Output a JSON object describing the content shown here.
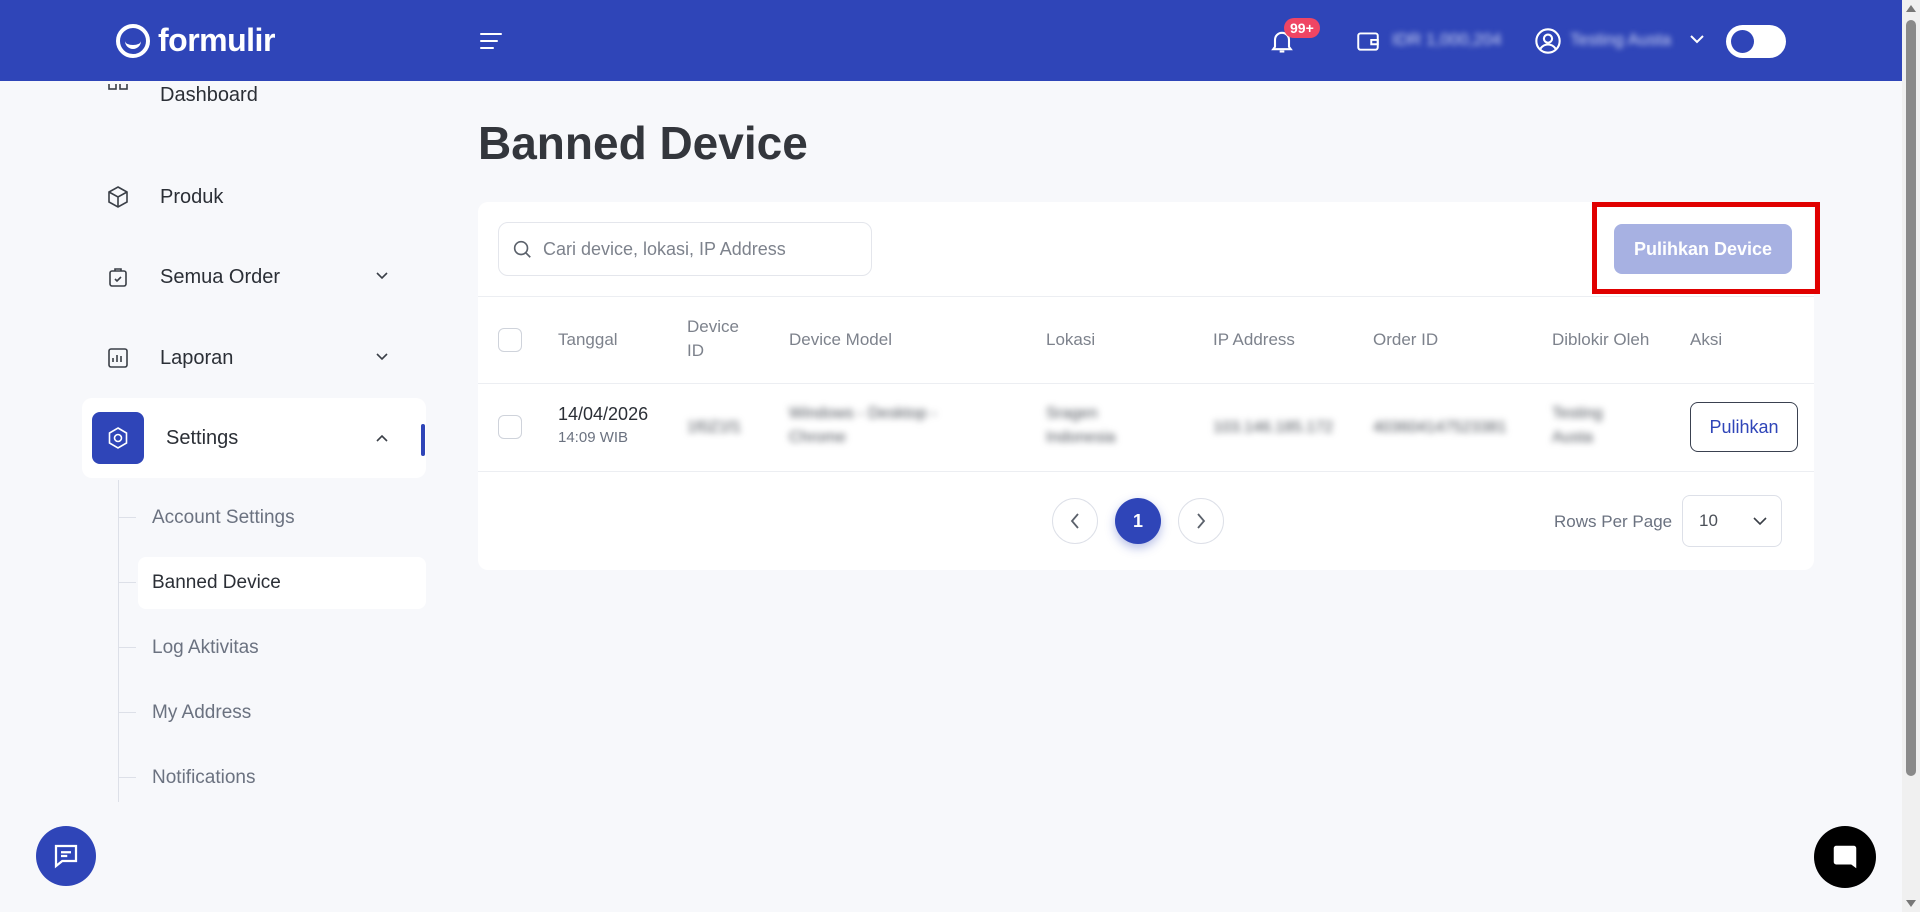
{
  "brand": {
    "name": "formulir",
    "primary": "#2f45b8"
  },
  "header": {
    "notification_badge": "99+",
    "balance": "IDR 1,000,204",
    "user_name": "Testing Austa"
  },
  "sidebar": {
    "items": [
      {
        "label": "Dashboard",
        "icon": "dashboard-icon"
      },
      {
        "label": "Produk",
        "icon": "box-icon"
      },
      {
        "label": "Semua Order",
        "icon": "order-bag-icon"
      },
      {
        "label": "Laporan",
        "icon": "report-icon"
      },
      {
        "label": "Settings",
        "icon": "gear-icon"
      }
    ],
    "settings_sub": [
      {
        "label": "Account Settings"
      },
      {
        "label": "Banned Device"
      },
      {
        "label": "Log Aktivitas"
      },
      {
        "label": "My Address"
      },
      {
        "label": "Notifications"
      }
    ]
  },
  "page": {
    "title": "Banned Device",
    "search_placeholder": "Cari device, lokasi, IP Address",
    "restore_all_label": "Pulihkan Device"
  },
  "table": {
    "columns": {
      "tanggal": "Tanggal",
      "device_id_1": "Device",
      "device_id_2": "ID",
      "device_model": "Device Model",
      "lokasi": "Lokasi",
      "ip": "IP Address",
      "order_id": "Order ID",
      "blocked_by": "Diblokir Oleh",
      "aksi": "Aksi"
    },
    "rows": [
      {
        "date": "14/04/2026",
        "time": "14:09 WIB",
        "device_id": "1f0Z1f1",
        "device_model_1": "Windows - Desktop -",
        "device_model_2": "Chrome",
        "location_1": "Sragen",
        "location_2": "Indonesia",
        "ip": "103.146.185.172",
        "order_id": "403604147523381",
        "blocked_by_1": "Testing",
        "blocked_by_2": "Austa",
        "action_label": "Pulihkan"
      }
    ]
  },
  "pagination": {
    "current_page": "1",
    "rows_per_page_label": "Rows Per Page",
    "rows_per_page": "10"
  }
}
